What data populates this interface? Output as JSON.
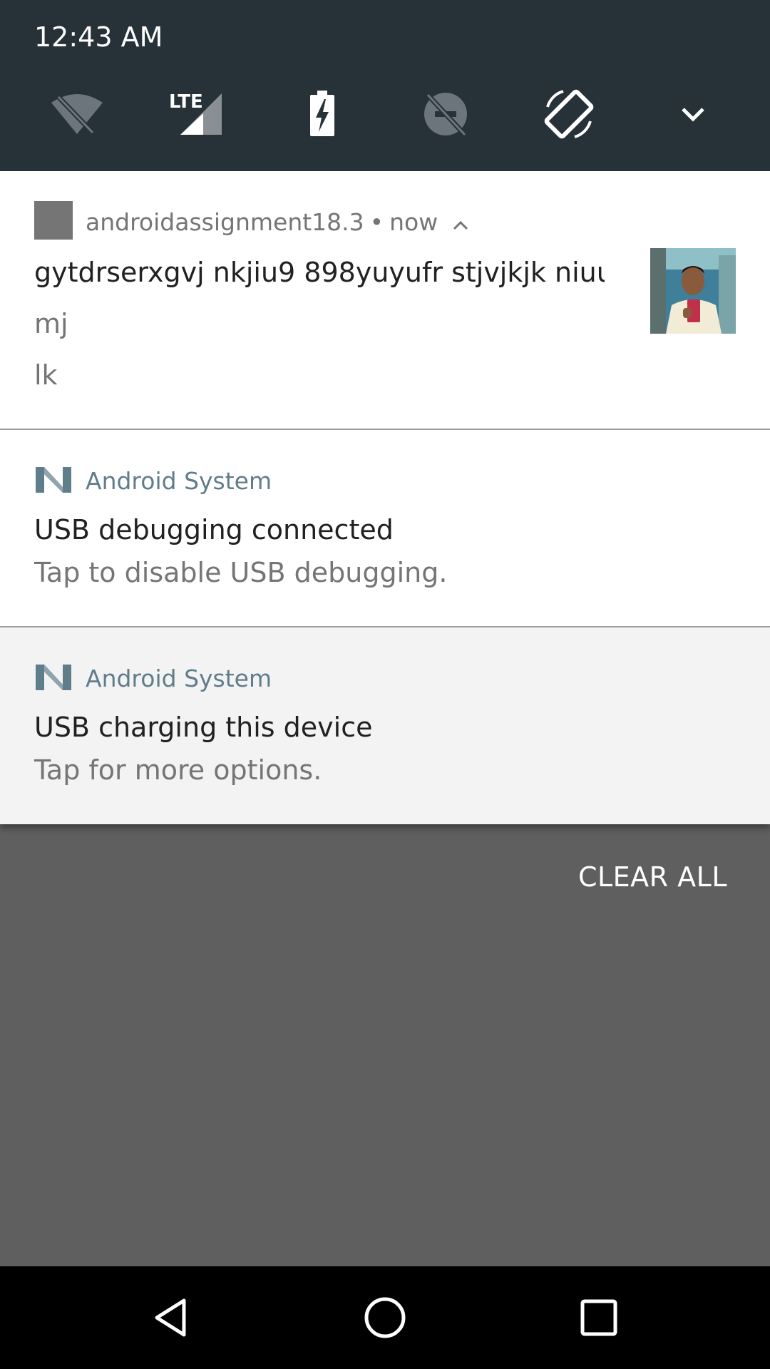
{
  "status": {
    "time": "12:43 AM"
  },
  "quick_settings": {
    "icons": [
      "wifi-off-icon",
      "lte-signal-icon",
      "battery-charging-icon",
      "do-not-disturb-off-icon",
      "auto-rotate-icon",
      "expand-chevron-icon"
    ],
    "lte_label": "LTE"
  },
  "notifications": [
    {
      "app": "androidassignment18.3",
      "separator": "•",
      "time": "now",
      "title": "gytdrserxgvj nkjiu9 898yuyufr stjvjkjk niuu..",
      "lines": [
        "mj",
        "lk"
      ]
    },
    {
      "app": "Android System",
      "title": "USB debugging connected",
      "text": "Tap to disable USB debugging."
    },
    {
      "app": "Android System",
      "title": "USB charging this device",
      "text": "Tap for more options."
    }
  ],
  "actions": {
    "clear_all": "CLEAR ALL"
  },
  "colors": {
    "header_bg": "#263238",
    "system_accent": "#607d8b",
    "shade_bg": "#5f5f5f"
  }
}
